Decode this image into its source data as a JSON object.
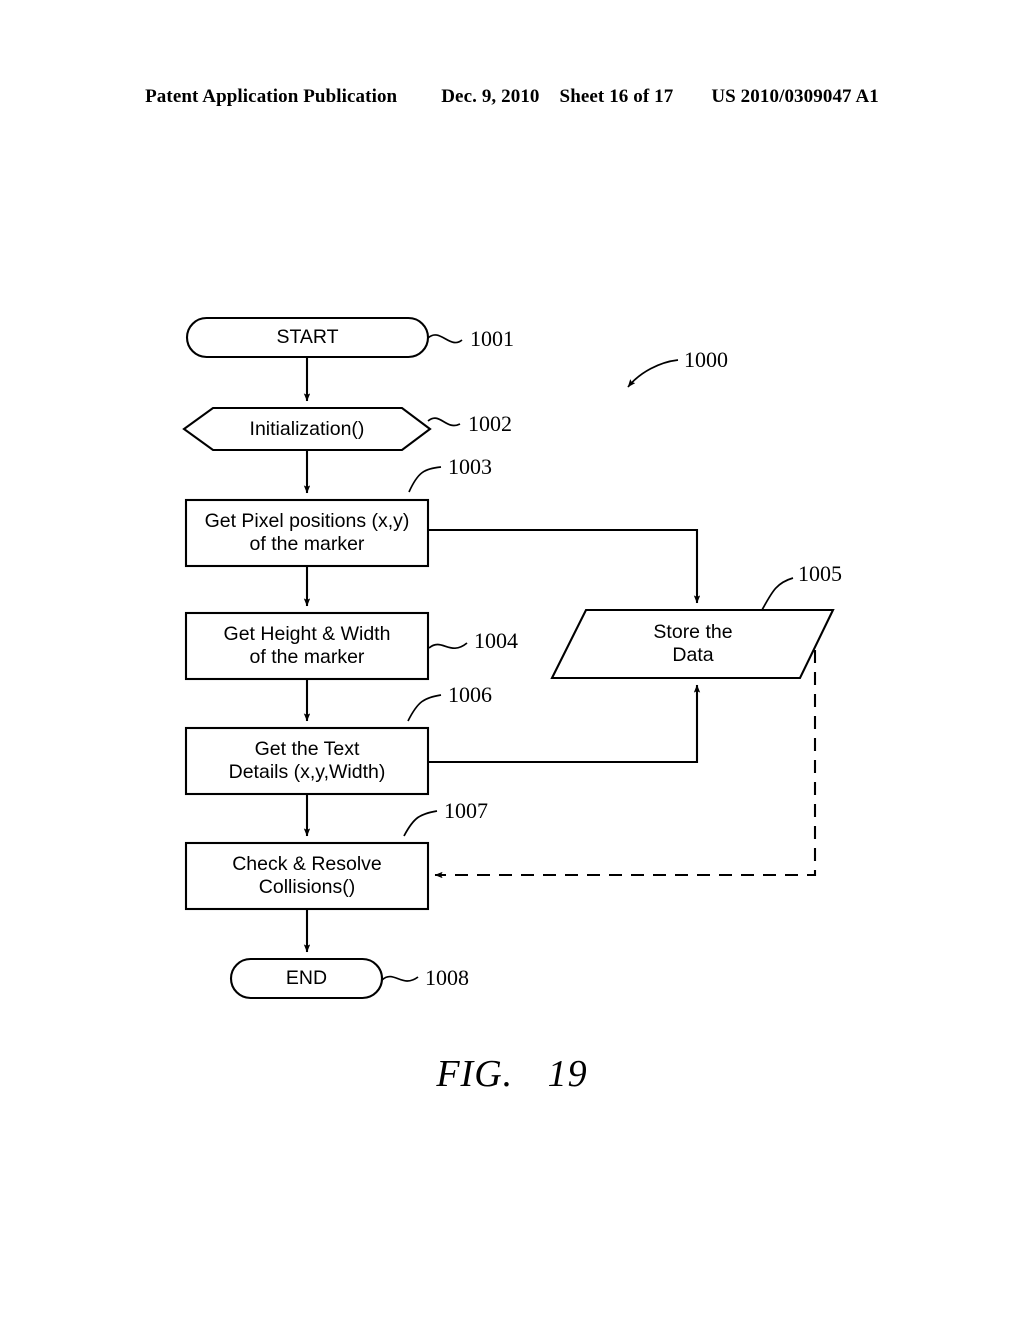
{
  "header": {
    "publication": "Patent Application Publication",
    "date": "Dec. 9, 2010",
    "sheet": "Sheet 16 of 17",
    "patent_number": "US 2010/0309047 A1"
  },
  "caption": {
    "fig_word": "FIG.",
    "fig_number": "19"
  },
  "diagram": {
    "overall_ref": "1000",
    "nodes": [
      {
        "id": "start",
        "ref": "1001",
        "shape": "stadium",
        "line1": "START",
        "line2": ""
      },
      {
        "id": "init",
        "ref": "1002",
        "shape": "hexagon",
        "line1": "Initialization()",
        "line2": ""
      },
      {
        "id": "pixel-pos",
        "ref": "1003",
        "shape": "rect",
        "line1": "Get Pixel positions (x,y)",
        "line2": "of the marker"
      },
      {
        "id": "height-width",
        "ref": "1004",
        "shape": "rect",
        "line1": "Get Height & Width",
        "line2": "of the marker"
      },
      {
        "id": "store-data",
        "ref": "1005",
        "shape": "parallelogram",
        "line1": "Store the",
        "line2": "Data"
      },
      {
        "id": "text-details",
        "ref": "1006",
        "shape": "rect",
        "line1": "Get the Text",
        "line2": "Details (x,y,Width)"
      },
      {
        "id": "collisions",
        "ref": "1007",
        "shape": "rect",
        "line1": "Check & Resolve",
        "line2": "Collisions()"
      },
      {
        "id": "end",
        "ref": "1008",
        "shape": "stadium",
        "line1": "END",
        "line2": ""
      }
    ],
    "edges": [
      {
        "from": "start",
        "to": "init",
        "style": "solid"
      },
      {
        "from": "init",
        "to": "pixel-pos",
        "style": "solid"
      },
      {
        "from": "pixel-pos",
        "to": "height-width",
        "style": "solid"
      },
      {
        "from": "pixel-pos",
        "to": "store-data",
        "style": "solid"
      },
      {
        "from": "height-width",
        "to": "text-details",
        "style": "solid"
      },
      {
        "from": "text-details",
        "to": "store-data",
        "style": "solid"
      },
      {
        "from": "text-details",
        "to": "collisions",
        "style": "solid"
      },
      {
        "from": "store-data",
        "to": "collisions",
        "style": "dashed"
      },
      {
        "from": "collisions",
        "to": "end",
        "style": "solid"
      }
    ],
    "stroke_color": "#000000",
    "fill_color": "#ffffff"
  }
}
